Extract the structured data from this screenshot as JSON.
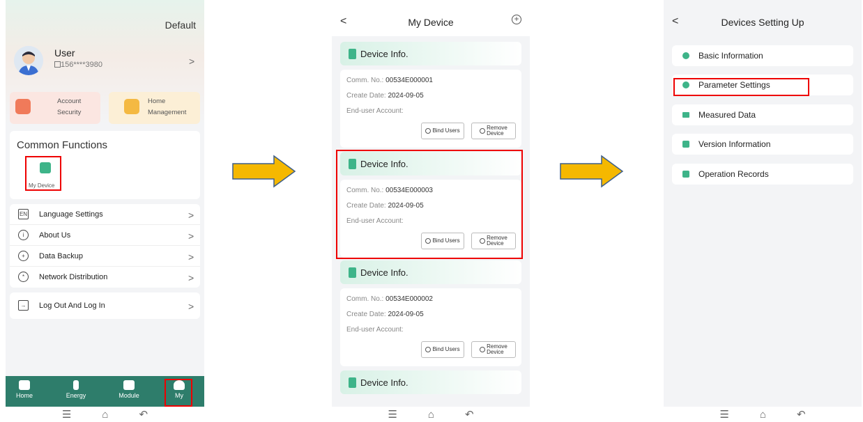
{
  "screen1": {
    "profile_mode": "Default",
    "user_name": "User",
    "user_phone": "156****3980",
    "quick_actions": [
      {
        "label_line1": "Account",
        "label_line2": "Security",
        "color": "#f07a5a"
      },
      {
        "label_line1": "Home",
        "label_line2": "Management",
        "color": "#f4b942"
      }
    ],
    "common_functions_title": "Common Functions",
    "my_device_label": "My Device",
    "menu_items": [
      {
        "label": "Language Settings",
        "icon_text": "EN"
      },
      {
        "label": "About Us",
        "icon_text": "i"
      },
      {
        "label": "Data Backup",
        "icon_text": "+"
      },
      {
        "label": "Network Distribution",
        "icon_text": "*"
      }
    ],
    "logout_label": "Log Out And Log In",
    "tabs": [
      {
        "label": "Home"
      },
      {
        "label": "Energy"
      },
      {
        "label": "Module"
      },
      {
        "label": "My"
      }
    ]
  },
  "screen2": {
    "title": "My Device",
    "devices": [
      {
        "header": "Device Info.",
        "comm_label": "Comm. No.:",
        "comm_no": "00534E000001",
        "date_label": "Create Date:",
        "create_date": "2024-09-05",
        "account_label": "End-user Account:"
      },
      {
        "header": "Device Info.",
        "comm_label": "Comm. No.:",
        "comm_no": "00534E000003",
        "date_label": "Create Date:",
        "create_date": "2024-09-05",
        "account_label": "End-user Account:"
      },
      {
        "header": "Device Info.",
        "comm_label": "Comm. No.:",
        "comm_no": "00534E000002",
        "date_label": "Create Date:",
        "create_date": "2024-09-05",
        "account_label": "End-user Account:"
      },
      {
        "header": "Device Info."
      }
    ],
    "bind_users_label": "Bind Users",
    "remove_device_line1": "Remove",
    "remove_device_line2": "Device"
  },
  "screen3": {
    "title": "Devices Setting Up",
    "items": [
      {
        "label": "Basic Information"
      },
      {
        "label": "Parameter Settings"
      },
      {
        "label": "Measured Data"
      },
      {
        "label": "Version Information"
      },
      {
        "label": "Operation Records"
      }
    ]
  },
  "colors": {
    "brand_green": "#3eb489",
    "tabbar": "#2e7d6b",
    "highlight": "#e00000",
    "arrow": "#f5b800"
  }
}
